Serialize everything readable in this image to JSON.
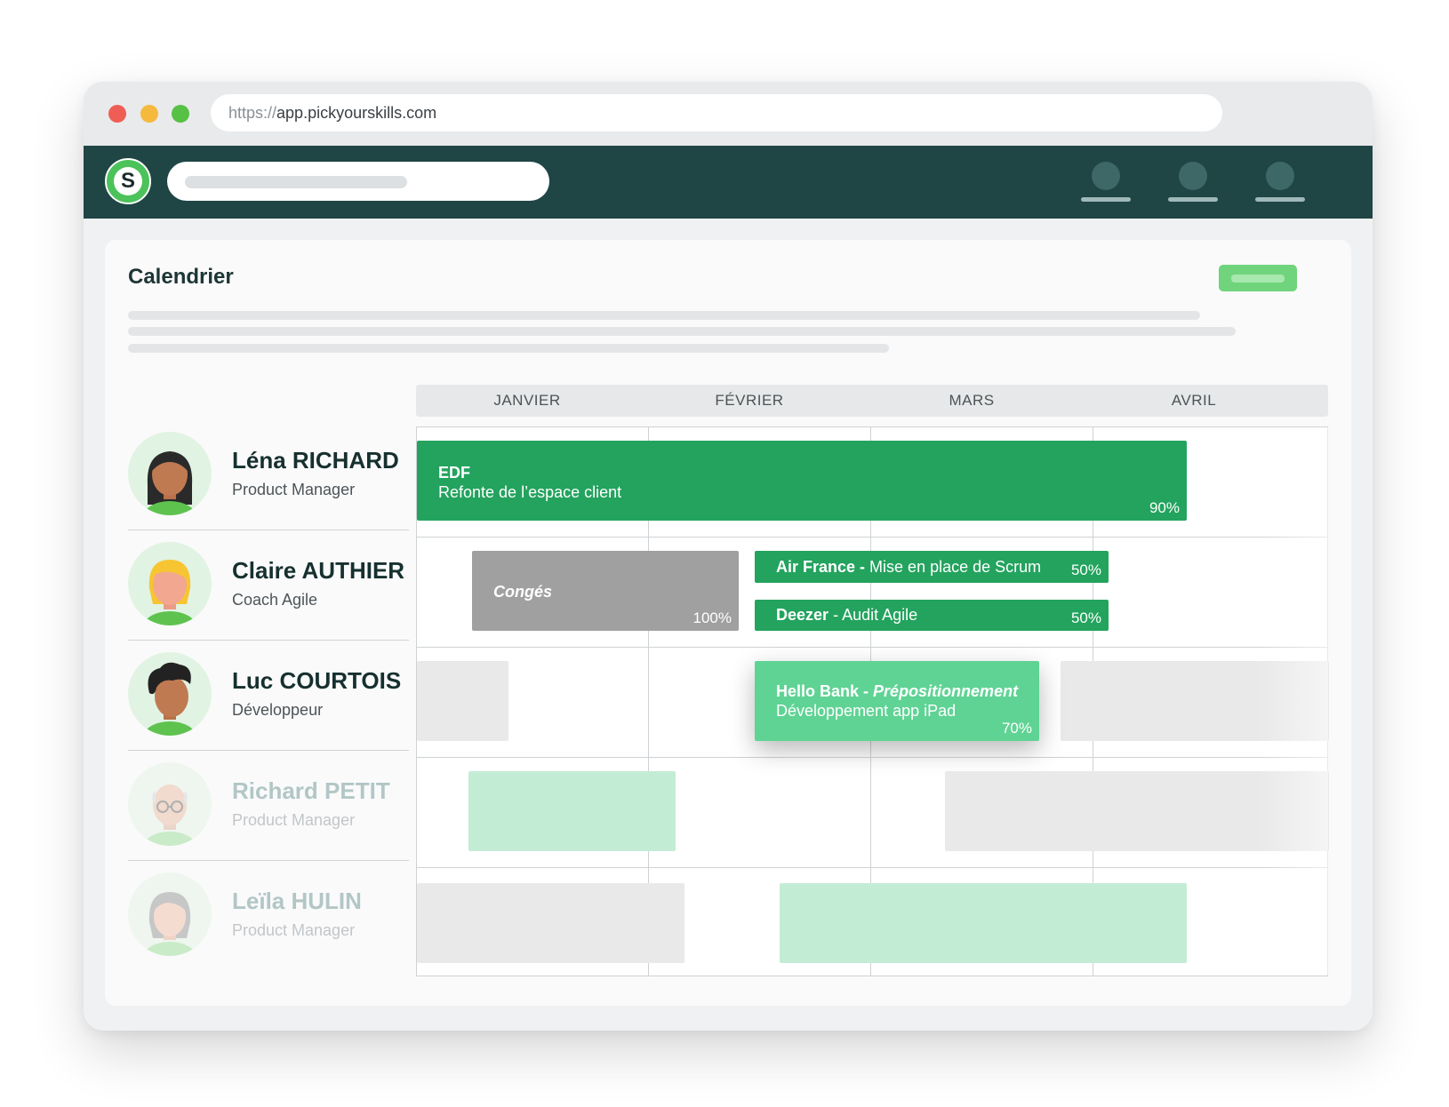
{
  "browser": {
    "url_protocol": "https://",
    "url_host": "app.pickyourskills.com"
  },
  "topnav": {
    "logo_letter": "S",
    "user_slots": 3
  },
  "page": {
    "title": "Calendrier"
  },
  "calendar": {
    "months": [
      "JANVIER",
      "FÉVRIER",
      "MARS",
      "AVRIL"
    ],
    "people": [
      {
        "name": "Léna RICHARD",
        "role": "Product Manager"
      },
      {
        "name": "Claire AUTHIER",
        "role": "Coach Agile"
      },
      {
        "name": "Luc COURTOIS",
        "role": "Développeur"
      },
      {
        "name": "Richard PETIT",
        "role": "Product Manager"
      },
      {
        "name": "Leïla HULIN",
        "role": "Product Manager"
      }
    ],
    "assignments": {
      "edf": {
        "client": "EDF",
        "project": "Refonte de l’espace client",
        "allocation": "90%"
      },
      "conges": {
        "label": "Congés",
        "allocation": "100%"
      },
      "airfrance": {
        "client": "Air France -",
        "project": "Mise en place de Scrum",
        "allocation": "50%"
      },
      "deezer": {
        "client": "Deezer",
        "project": "- Audit Agile",
        "allocation": "50%"
      },
      "hellobank": {
        "client": "Hello Bank -",
        "client_emphasis": "Prépositionnement",
        "project": "Développement app iPad",
        "allocation": "70%"
      }
    }
  },
  "colors": {
    "nav_background": "#1f4545",
    "brand_green": "#4cc25a",
    "bar_dark_green": "#23a35e",
    "bar_light_green": "#5fd394",
    "bar_grey": "#a0a0a0",
    "title_text": "#1d3535"
  }
}
